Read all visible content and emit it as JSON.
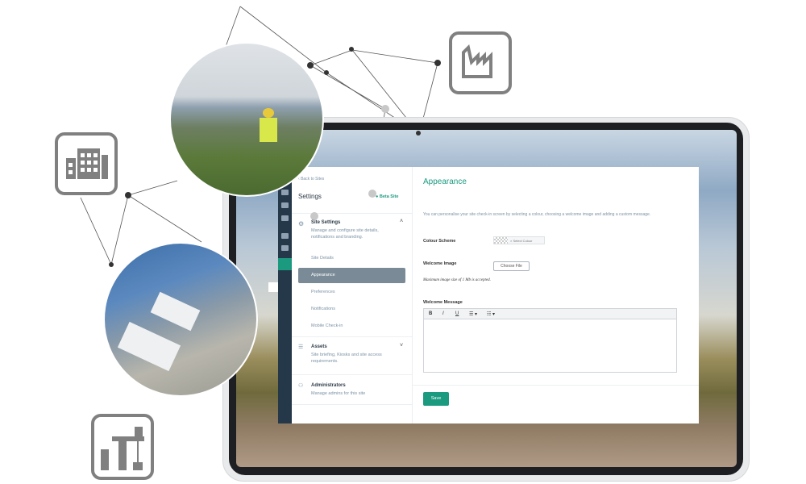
{
  "sidebar": {
    "back_link": "Back to Sites",
    "title": "Settings",
    "site_badge": "Beta Site",
    "sections": [
      {
        "title": "Site Settings",
        "description": "Manage and configure site details, notifications and branding.",
        "expanded": true,
        "items": [
          "Site Details",
          "Appearance",
          "Preferences",
          "Notifications",
          "Mobile Check-in"
        ],
        "active_item": "Appearance"
      },
      {
        "title": "Assets",
        "description": "Site briefing, Kiosks and site access requirements.",
        "expanded": false
      },
      {
        "title": "Administrators",
        "description": "Manage admins for this site"
      }
    ]
  },
  "main": {
    "title": "Appearance",
    "intro": "You can personalise your site check-in screen by selecting a colour, choosing a welcome image and adding a custom message.",
    "colour_scheme_label": "Colour Scheme",
    "select_colour_label": "Select Colour",
    "welcome_image_label": "Welcome Image",
    "choose_file_label": "Choose File",
    "image_note": "Maximum image size of 1 Mb is accepted.",
    "welcome_message_label": "Welcome Message",
    "editor_toolbar": {
      "bold": "B",
      "italic": "I",
      "underline": "U",
      "bullets": "☰ ▾",
      "numbered": "☷ ▾"
    },
    "welcome_message_value": "",
    "save_label": "Save"
  },
  "colors": {
    "accent": "#1c9a80",
    "rail": "#25384a",
    "active_item": "#7a8b97"
  },
  "icons": [
    "factory-icon",
    "office-building-icon",
    "construction-crane-icon"
  ]
}
